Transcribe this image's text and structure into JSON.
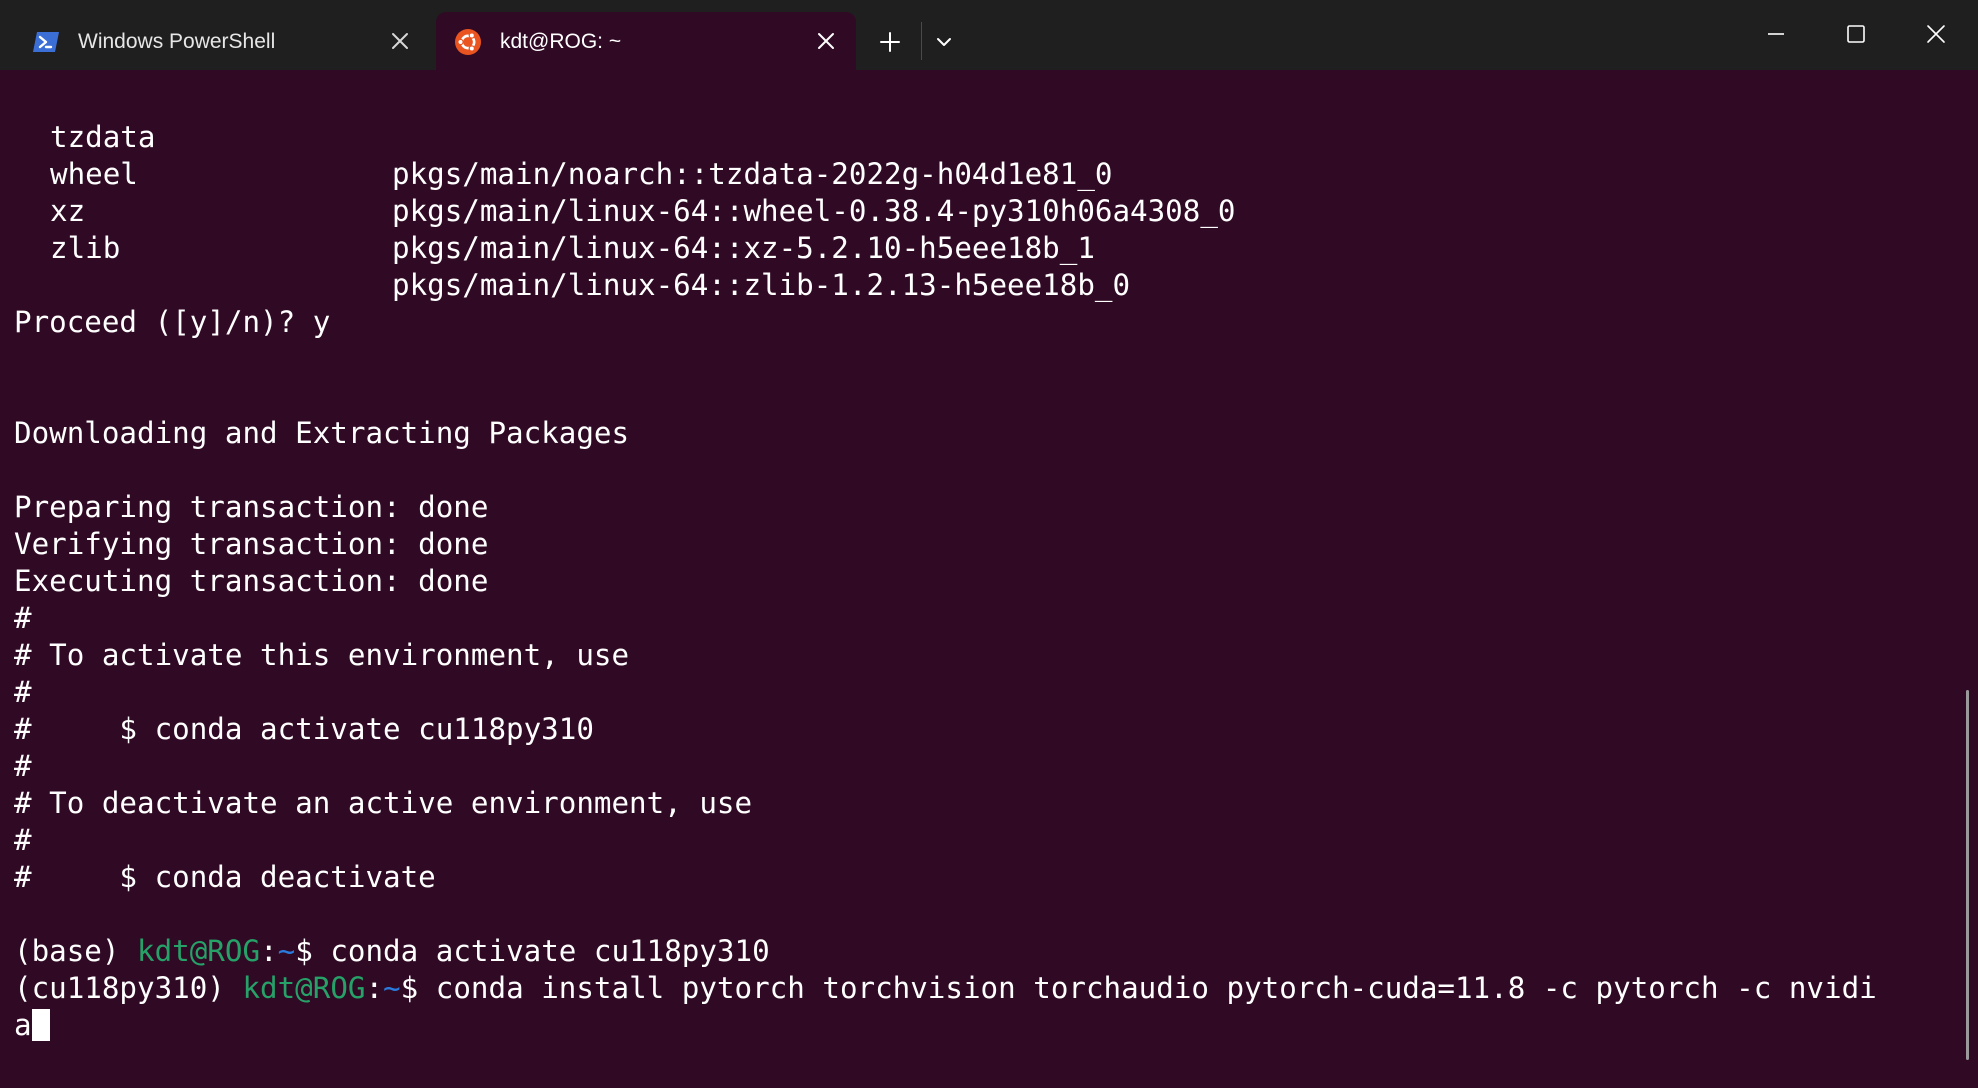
{
  "tabs": [
    {
      "title": "Windows PowerShell",
      "icon": "powershell-icon",
      "active": false
    },
    {
      "title": "kdt@ROG: ~",
      "icon": "ubuntu-icon",
      "active": true
    }
  ],
  "titlebar_buttons": [
    "new-tab",
    "dropdown",
    "minimize",
    "maximize",
    "close"
  ],
  "terminal": {
    "packages": [
      {
        "name": "tzdata",
        "spec": "pkgs/main/noarch::tzdata-2022g-h04d1e81_0"
      },
      {
        "name": "wheel",
        "spec": "pkgs/main/linux-64::wheel-0.38.4-py310h06a4308_0"
      },
      {
        "name": "xz",
        "spec": "pkgs/main/linux-64::xz-5.2.10-h5eee18b_1"
      },
      {
        "name": "zlib",
        "spec": "pkgs/main/linux-64::zlib-1.2.13-h5eee18b_0"
      }
    ],
    "proceed_prompt": "Proceed ([y]/n)? y",
    "downloading": "Downloading and Extracting Packages",
    "status_lines": [
      "Preparing transaction: done",
      "Verifying transaction: done",
      "Executing transaction: done"
    ],
    "comment_lines": [
      "#",
      "# To activate this environment, use",
      "#",
      "#     $ conda activate cu118py310",
      "#",
      "# To deactivate an active environment, use",
      "#",
      "#     $ conda deactivate"
    ],
    "prompt1": {
      "env": "(base) ",
      "user_host": "kdt@ROG",
      "colon": ":",
      "path": "~",
      "symbol": "$ ",
      "command": "conda activate cu118py310"
    },
    "prompt2": {
      "env": "(cu118py310) ",
      "user_host": "kdt@ROG",
      "colon": ":",
      "path": "~",
      "symbol": "$ ",
      "command": "conda install pytorch torchvision torchaudio pytorch-cuda=11.8 -c pytorch -c nvidi",
      "continuation": "a"
    }
  },
  "colors": {
    "background": "#300a24",
    "titlebar": "#1f1f1f",
    "prompt_user": "#26a269",
    "prompt_path": "#2a7bde",
    "text": "#ffffff"
  }
}
